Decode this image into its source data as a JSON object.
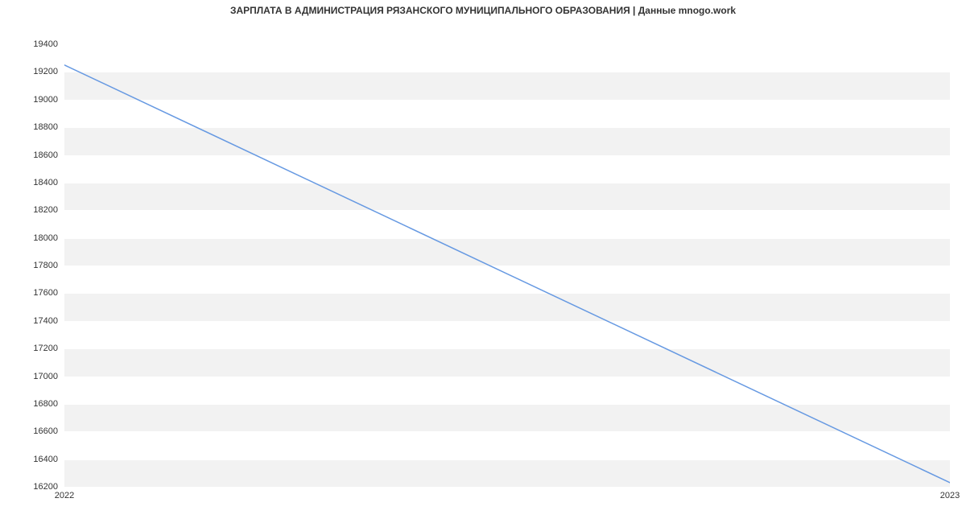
{
  "chart_data": {
    "type": "line",
    "title": "ЗАРПЛАТА В АДМИНИСТРАЦИЯ РЯЗАНСКОГО МУНИЦИПАЛЬНОГО ОБРАЗОВАНИЯ | Данные mnogo.work",
    "x": [
      2022,
      2023
    ],
    "values": [
      19250,
      16230
    ],
    "xlabel": "",
    "ylabel": "",
    "x_ticks": [
      2022,
      2023
    ],
    "y_ticks": [
      16200,
      16400,
      16600,
      16800,
      17000,
      17200,
      17400,
      17600,
      17800,
      18000,
      18200,
      18400,
      18600,
      18800,
      19000,
      19200,
      19400
    ],
    "ylim": [
      16200,
      19400
    ],
    "xlim": [
      2022,
      2023
    ],
    "line_color": "#6699e2"
  }
}
